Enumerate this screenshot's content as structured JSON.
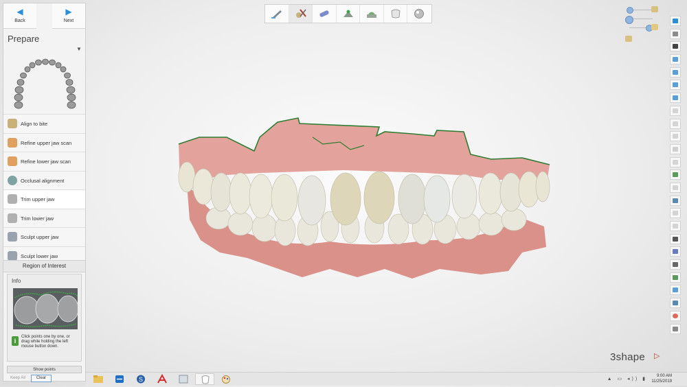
{
  "nav": {
    "back_label": "Back",
    "next_label": "Next"
  },
  "panel": {
    "title": "Prepare"
  },
  "steps": [
    {
      "label": "Align to bite",
      "icon": "align-bite-icon"
    },
    {
      "label": "Refine upper jaw scan",
      "icon": "refine-upper-icon"
    },
    {
      "label": "Refine lower jaw scan",
      "icon": "refine-lower-icon"
    },
    {
      "label": "Occlusal alignment",
      "icon": "occlusal-icon"
    },
    {
      "label": "Trim upper jaw",
      "icon": "trim-upper-icon",
      "active": true
    },
    {
      "label": "Trim lower jaw",
      "icon": "trim-lower-icon"
    },
    {
      "label": "Sculpt upper jaw",
      "icon": "sculpt-upper-icon"
    },
    {
      "label": "Sculpt lower jaw",
      "icon": "sculpt-lower-icon"
    }
  ],
  "roi": {
    "title": "Region of Interest",
    "info_title": "Info",
    "info_text": "Click points one by one, or drag while holding the left mouse button down.",
    "show_points_label": "Show points",
    "keep_all_label": "Keep All",
    "clear_label": "Clear"
  },
  "brand": {
    "logo_text": "3shape"
  },
  "taskbar": {
    "time": "9:00 AM",
    "date": "11/25/2019"
  },
  "colors": {
    "accent": "#2a8fd6",
    "gum": "#d98b86",
    "tooth": "#e9e6d6",
    "trim_line": "#2e7d32"
  }
}
